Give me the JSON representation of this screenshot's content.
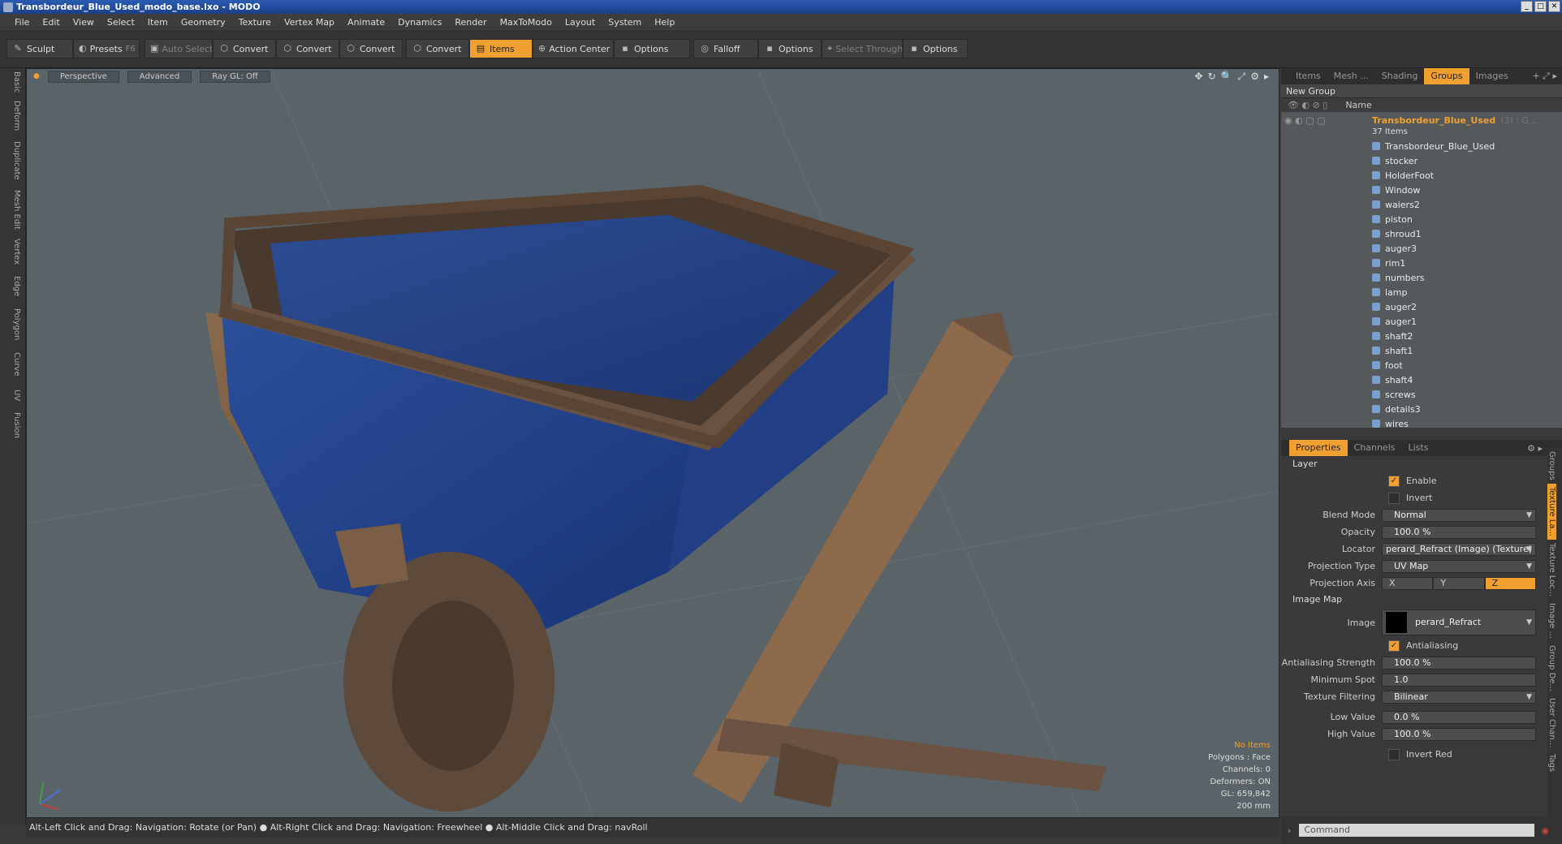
{
  "window": {
    "title": "Transbordeur_Blue_Used_modo_base.lxo - MODO"
  },
  "menu": [
    "File",
    "Edit",
    "View",
    "Select",
    "Item",
    "Geometry",
    "Texture",
    "Vertex Map",
    "Animate",
    "Dynamics",
    "Render",
    "MaxToModo",
    "Layout",
    "System",
    "Help"
  ],
  "toolbar": {
    "sculpt": "Sculpt",
    "presets": "Presets",
    "presets_key": "F6",
    "auto_select": "Auto Select",
    "convert1": "Convert",
    "convert2": "Convert",
    "convert3": "Convert",
    "convert4": "Convert",
    "items": "Items",
    "action_center": "Action Center",
    "options1": "Options",
    "falloff": "Falloff",
    "options2": "Options",
    "select_through": "Select Through",
    "options3": "Options"
  },
  "left_tabs": [
    "Basic",
    "Deform",
    "Duplicate",
    "Mesh Edit",
    "Vertex",
    "Edge",
    "Polygon",
    "Curve",
    "UV",
    "Fusion"
  ],
  "viewport": {
    "view": "Perspective",
    "shading": "Advanced",
    "raygl": "Ray GL: Off",
    "info": {
      "items": "No Items",
      "polygons": "Polygons : Face",
      "channels": "Channels: 0",
      "deformers": "Deformers: ON",
      "gl": "GL: 659,842",
      "scale": "200 mm"
    }
  },
  "status": "Alt-Left Click and Drag: Navigation: Rotate (or Pan) ● Alt-Right Click and Drag: Navigation: Freewheel ● Alt-Middle Click and Drag: navRoll",
  "panel_tabs": [
    "Items",
    "Mesh ...",
    "Shading",
    "Groups",
    "Images"
  ],
  "groups": {
    "new_group": "New Group",
    "name_col": "Name",
    "group_name": "Transbordeur_Blue_Used",
    "group_suffix": "(3) : G...",
    "count": "37 Items",
    "items": [
      "Transbordeur_Blue_Used",
      "stocker",
      "HolderFoot",
      "Window",
      "waiers2",
      "piston",
      "shroud1",
      "auger3",
      "rim1",
      "numbers",
      "lamp",
      "auger2",
      "auger1",
      "shaft2",
      "shaft1",
      "foot",
      "shaft4",
      "screws",
      "details3",
      "wires"
    ]
  },
  "props_tabs": [
    "Properties",
    "Channels",
    "Lists"
  ],
  "properties": {
    "layer": "Layer",
    "enable": "Enable",
    "invert": "Invert",
    "blend_mode_label": "Blend Mode",
    "blend_mode": "Normal",
    "opacity_label": "Opacity",
    "opacity": "100.0 %",
    "locator_label": "Locator",
    "locator": "perard_Refract (Image) (Texture)",
    "projection_type_label": "Projection Type",
    "projection_type": "UV Map",
    "projection_axis_label": "Projection Axis",
    "axis": [
      "X",
      "Y",
      "Z"
    ],
    "image_map": "Image Map",
    "image_label": "Image",
    "image": "perard_Refract",
    "antialiasing": "Antialiasing",
    "aa_strength_label": "Antialiasing Strength",
    "aa_strength": "100.0 %",
    "min_spot_label": "Minimum Spot",
    "min_spot": "1.0",
    "filtering_label": "Texture Filtering",
    "filtering": "Bilinear",
    "low_label": "Low Value",
    "low": "0.0 %",
    "high_label": "High Value",
    "high": "100.0 %",
    "invert_red": "Invert Red"
  },
  "side_tabs": [
    "Groups",
    "Texture La...",
    "Texture Loc...",
    "Image ...",
    "Group De...",
    "User Chan...",
    "Tags"
  ],
  "command_placeholder": "Command"
}
